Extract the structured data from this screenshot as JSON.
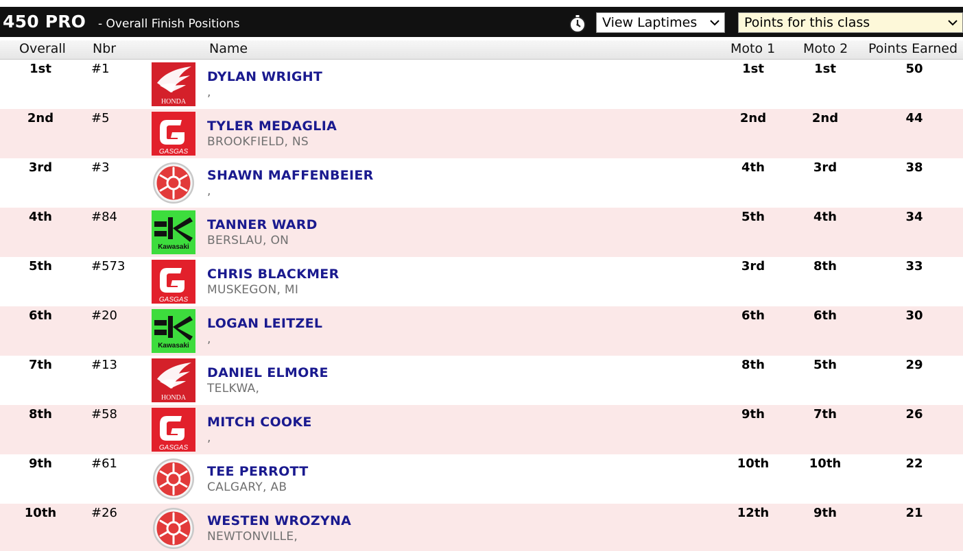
{
  "header": {
    "class_name": "450 PRO",
    "subtitle": "- Overall Finish Positions",
    "laptimes_select": "View Laptimes",
    "points_select": "Points for this class"
  },
  "columns": {
    "overall": "Overall",
    "nbr": "Nbr",
    "name": "Name",
    "moto1": "Moto 1",
    "moto2": "Moto 2",
    "points": "Points Earned"
  },
  "brand_labels": {
    "honda": "HONDA",
    "gasgas": "GASGAS",
    "kawasaki": "Kawasaki"
  },
  "colors": {
    "title_bar": "#111111",
    "row_alt": "#fbe8e8",
    "name_link": "#1a1a8f",
    "honda": "#d4202a",
    "gasgas": "#e2202b",
    "kawasaki": "#3ddc3d"
  },
  "rows": [
    {
      "overall": "1st",
      "nbr": "#1",
      "brand": "honda",
      "name": "DYLAN WRIGHT",
      "city": ",",
      "moto1": "1st",
      "moto2": "1st",
      "points": "50"
    },
    {
      "overall": "2nd",
      "nbr": "#5",
      "brand": "gasgas",
      "name": "TYLER MEDAGLIA",
      "city": "BROOKFIELD, NS",
      "moto1": "2nd",
      "moto2": "2nd",
      "points": "44"
    },
    {
      "overall": "3rd",
      "nbr": "#3",
      "brand": "yamaha",
      "name": "SHAWN MAFFENBEIER",
      "city": ",",
      "moto1": "4th",
      "moto2": "3rd",
      "points": "38"
    },
    {
      "overall": "4th",
      "nbr": "#84",
      "brand": "kawasaki",
      "name": "TANNER WARD",
      "city": "BERSLAU, ON",
      "moto1": "5th",
      "moto2": "4th",
      "points": "34"
    },
    {
      "overall": "5th",
      "nbr": "#573",
      "brand": "gasgas",
      "name": "CHRIS BLACKMER",
      "city": "MUSKEGON, MI",
      "moto1": "3rd",
      "moto2": "8th",
      "points": "33"
    },
    {
      "overall": "6th",
      "nbr": "#20",
      "brand": "kawasaki",
      "name": "LOGAN LEITZEL",
      "city": ",",
      "moto1": "6th",
      "moto2": "6th",
      "points": "30"
    },
    {
      "overall": "7th",
      "nbr": "#13",
      "brand": "honda",
      "name": "DANIEL ELMORE",
      "city": "TELKWA,",
      "moto1": "8th",
      "moto2": "5th",
      "points": "29"
    },
    {
      "overall": "8th",
      "nbr": "#58",
      "brand": "gasgas",
      "name": "MITCH COOKE",
      "city": ",",
      "moto1": "9th",
      "moto2": "7th",
      "points": "26"
    },
    {
      "overall": "9th",
      "nbr": "#61",
      "brand": "yamaha",
      "name": "TEE PERROTT",
      "city": "CALGARY, AB",
      "moto1": "10th",
      "moto2": "10th",
      "points": "22"
    },
    {
      "overall": "10th",
      "nbr": "#26",
      "brand": "yamaha",
      "name": "WESTEN WROZYNA",
      "city": "NEWTONVILLE,",
      "moto1": "12th",
      "moto2": "9th",
      "points": "21"
    }
  ]
}
